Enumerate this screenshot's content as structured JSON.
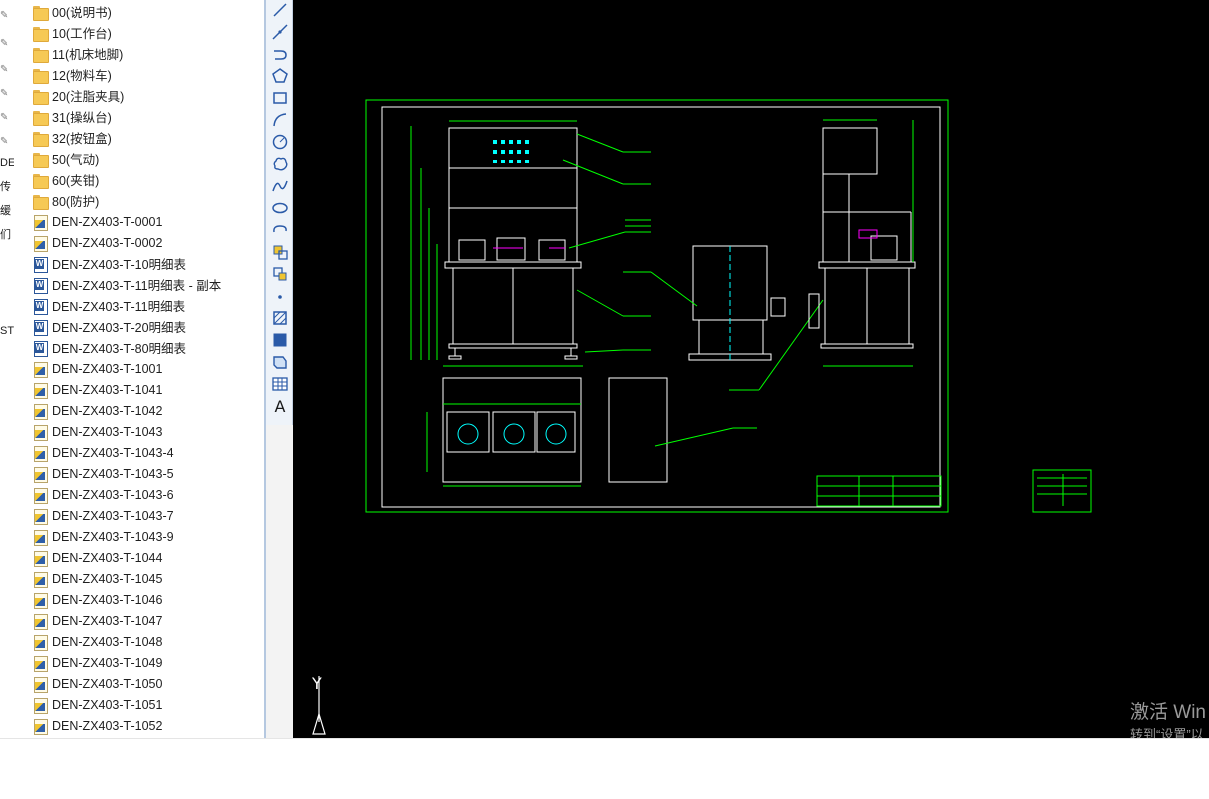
{
  "nav_strip": {
    "cut_labels": [
      "DE",
      "传",
      "缓",
      "们",
      "ST"
    ]
  },
  "file_list": {
    "items": [
      {
        "name": "00(说明书)",
        "type": "folder"
      },
      {
        "name": "10(工作台)",
        "type": "folder"
      },
      {
        "name": "11(机床地脚)",
        "type": "folder"
      },
      {
        "name": "12(物料车)",
        "type": "folder"
      },
      {
        "name": "20(注脂夹具)",
        "type": "folder"
      },
      {
        "name": "31(操纵台)",
        "type": "folder"
      },
      {
        "name": "32(按钮盒)",
        "type": "folder"
      },
      {
        "name": "50(气动)",
        "type": "folder"
      },
      {
        "name": "60(夹钳)",
        "type": "folder"
      },
      {
        "name": "80(防护)",
        "type": "folder"
      },
      {
        "name": "DEN-ZX403-T-0001",
        "type": "dwg"
      },
      {
        "name": "DEN-ZX403-T-0002",
        "type": "dwg"
      },
      {
        "name": "DEN-ZX403-T-10明细表",
        "type": "doc"
      },
      {
        "name": "DEN-ZX403-T-11明细表 - 副本",
        "type": "doc"
      },
      {
        "name": "DEN-ZX403-T-11明细表",
        "type": "doc"
      },
      {
        "name": "DEN-ZX403-T-20明细表",
        "type": "doc"
      },
      {
        "name": "DEN-ZX403-T-80明细表",
        "type": "doc"
      },
      {
        "name": "DEN-ZX403-T-1001",
        "type": "dwg"
      },
      {
        "name": "DEN-ZX403-T-1041",
        "type": "dwg"
      },
      {
        "name": "DEN-ZX403-T-1042",
        "type": "dwg"
      },
      {
        "name": "DEN-ZX403-T-1043",
        "type": "dwg"
      },
      {
        "name": "DEN-ZX403-T-1043-4",
        "type": "dwg"
      },
      {
        "name": "DEN-ZX403-T-1043-5",
        "type": "dwg"
      },
      {
        "name": "DEN-ZX403-T-1043-6",
        "type": "dwg"
      },
      {
        "name": "DEN-ZX403-T-1043-7",
        "type": "dwg"
      },
      {
        "name": "DEN-ZX403-T-1043-9",
        "type": "dwg"
      },
      {
        "name": "DEN-ZX403-T-1044",
        "type": "dwg"
      },
      {
        "name": "DEN-ZX403-T-1045",
        "type": "dwg"
      },
      {
        "name": "DEN-ZX403-T-1046",
        "type": "dwg"
      },
      {
        "name": "DEN-ZX403-T-1047",
        "type": "dwg"
      },
      {
        "name": "DEN-ZX403-T-1048",
        "type": "dwg"
      },
      {
        "name": "DEN-ZX403-T-1049",
        "type": "dwg"
      },
      {
        "name": "DEN-ZX403-T-1050",
        "type": "dwg"
      },
      {
        "name": "DEN-ZX403-T-1051",
        "type": "dwg"
      },
      {
        "name": "DEN-ZX403-T-1052",
        "type": "dwg"
      }
    ]
  },
  "draw_toolbar": {
    "tools": [
      "line-icon",
      "construction-line-icon",
      "polyline-icon",
      "polygon-icon",
      "rectangle-icon",
      "arc-icon",
      "circle-icon",
      "revision-cloud-icon",
      "spline-icon",
      "ellipse-icon",
      "ellipse-arc-icon",
      "insert-block-icon",
      "make-block-icon",
      "point-icon",
      "hatch-icon",
      "gradient-icon",
      "region-icon",
      "table-icon",
      "multiline-text-icon"
    ],
    "text_tool_label": "A"
  },
  "cad": {
    "ucs_y_label": "Y",
    "colors": {
      "drawing": "#00ff00",
      "background": "#000000",
      "frame": "#ffffff",
      "accent": "#ff00ff",
      "center": "#00ffff"
    }
  },
  "watermark": {
    "line1": "激活 Win",
    "line2": "转到“设置”以"
  }
}
